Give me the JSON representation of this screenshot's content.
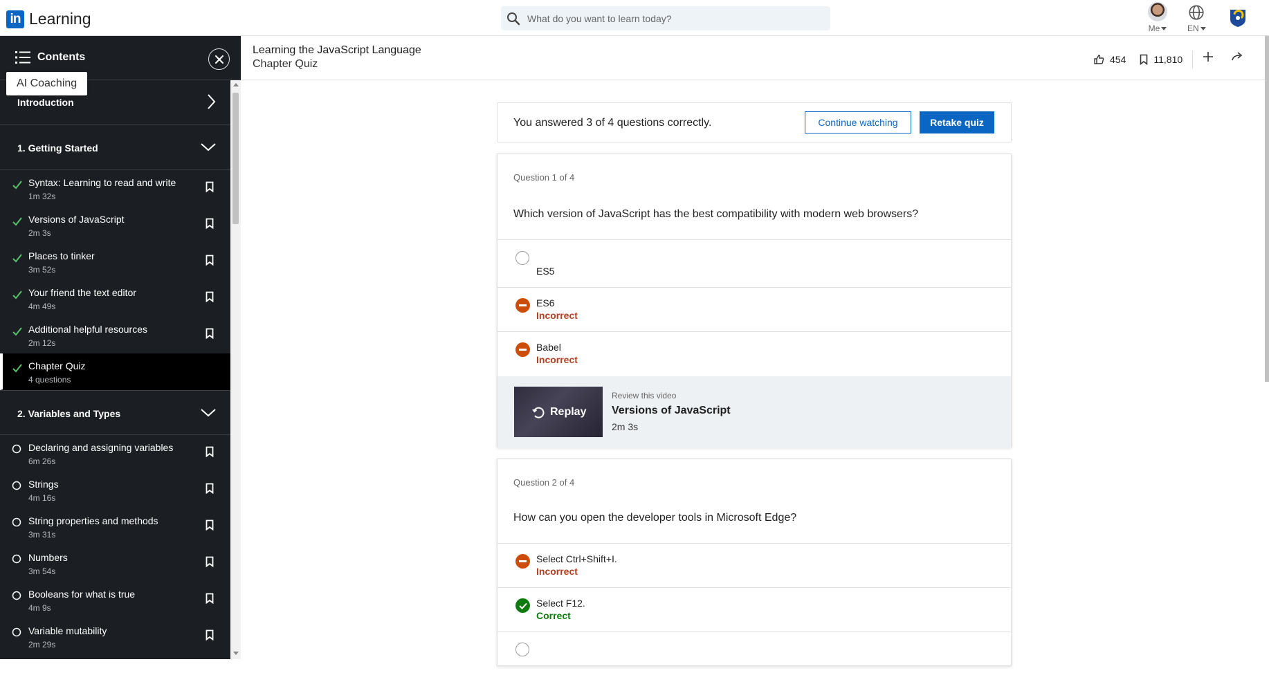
{
  "topnav": {
    "logo_badge": "in",
    "logo_text": "Learning",
    "search_placeholder": "What do you want to learn today?",
    "me_label": "Me",
    "lang_label": "EN"
  },
  "sidebar": {
    "title": "Contents",
    "tooltip": "AI Coaching",
    "intro_label": "Introduction",
    "sections": [
      {
        "label": "1. Getting Started",
        "items": [
          {
            "title": "Syntax: Learning to read and write",
            "duration": "1m 32s",
            "status": "done"
          },
          {
            "title": "Versions of JavaScript",
            "duration": "2m 3s",
            "status": "done"
          },
          {
            "title": "Places to tinker",
            "duration": "3m 52s",
            "status": "done"
          },
          {
            "title": "Your friend the text editor",
            "duration": "4m 49s",
            "status": "done"
          },
          {
            "title": "Additional helpful resources",
            "duration": "2m 12s",
            "status": "done"
          },
          {
            "title": "Chapter Quiz",
            "duration": "4 questions",
            "status": "done",
            "active": true
          }
        ]
      },
      {
        "label": "2. Variables and Types",
        "items": [
          {
            "title": "Declaring and assigning variables",
            "duration": "6m 26s",
            "status": "todo"
          },
          {
            "title": "Strings",
            "duration": "4m 16s",
            "status": "todo"
          },
          {
            "title": "String properties and methods",
            "duration": "3m 31s",
            "status": "todo"
          },
          {
            "title": "Numbers",
            "duration": "3m 54s",
            "status": "todo"
          },
          {
            "title": "Booleans for what is true",
            "duration": "4m 9s",
            "status": "todo"
          },
          {
            "title": "Variable mutability",
            "duration": "2m 29s",
            "status": "todo"
          }
        ]
      }
    ]
  },
  "course": {
    "title": "Learning the JavaScript Language",
    "subtitle": "Chapter Quiz",
    "likes": "454",
    "saves": "11,810"
  },
  "result": {
    "text": "You answered 3 of 4 questions correctly.",
    "continue_label": "Continue watching",
    "retake_label": "Retake quiz"
  },
  "questions": [
    {
      "number": "Question 1 of 4",
      "text": "Which version of JavaScript has the best compatibility with modern web browsers?",
      "options": [
        {
          "label": "ES5",
          "state": "unselected",
          "feedback": ""
        },
        {
          "label": "ES6",
          "state": "incorrect",
          "feedback": "Incorrect"
        },
        {
          "label": "Babel",
          "state": "incorrect",
          "feedback": "Incorrect"
        }
      ],
      "review": {
        "sup": "Review this video",
        "replay": "Replay",
        "title": "Versions of JavaScript",
        "duration": "2m 3s"
      }
    },
    {
      "number": "Question 2 of 4",
      "text": "How can you open the developer tools in Microsoft Edge?",
      "options": [
        {
          "label": "Select Ctrl+Shift+I.",
          "state": "incorrect",
          "feedback": "Incorrect"
        },
        {
          "label": "Select F12.",
          "state": "correct",
          "feedback": "Correct"
        },
        {
          "label": "",
          "state": "unselected",
          "feedback": ""
        }
      ]
    }
  ],
  "colors": {
    "brand": "#0a66c2",
    "sidebar_bg": "#1b1f23",
    "incorrect": "#cc4d0a",
    "correct": "#0f7b0f",
    "check": "#57c26a"
  }
}
